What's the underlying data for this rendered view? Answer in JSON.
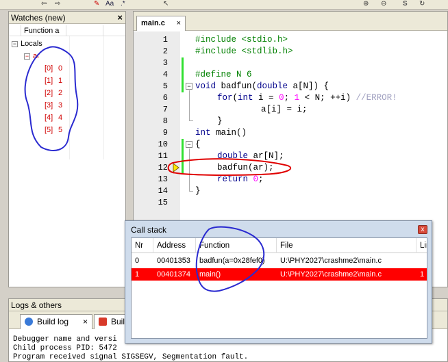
{
  "toolbar": {
    "icons": [
      "back-arrow-icon",
      "forward-arrow-icon",
      "highlight-icon",
      "match-case-icon",
      "regex-icon",
      "select-icon",
      "zoom-in-icon",
      "zoom-out-icon",
      "spell-check-icon",
      "refresh-icon"
    ],
    "match_case_label": "Aa",
    "regex_label": ".*",
    "spell_label": "S"
  },
  "watches": {
    "title": "Watches (new)",
    "close": "×",
    "column_function": "Function a",
    "locals_label": "Locals",
    "var_name": "ar",
    "items": [
      {
        "index": "[0]",
        "value": "0"
      },
      {
        "index": "[1]",
        "value": "1"
      },
      {
        "index": "[2]",
        "value": "2"
      },
      {
        "index": "[3]",
        "value": "3"
      },
      {
        "index": "[4]",
        "value": "4"
      },
      {
        "index": "[5]",
        "value": "5"
      }
    ]
  },
  "editor": {
    "tab_label": "main.c",
    "tab_close": "×",
    "line_numbers": [
      "1",
      "2",
      "3",
      "4",
      "5",
      "6",
      "7",
      "8",
      "9",
      "10",
      "11",
      "12",
      "13",
      "14",
      "15"
    ],
    "lines": {
      "l1": "#include <stdio.h>",
      "l2": "#include <stdlib.h>",
      "l4": "#define N 6",
      "l5a": "void",
      "l5b": " badfun(",
      "l5c": "double",
      "l5d": " a[N]) {",
      "l6a": "for",
      "l6b": "(",
      "l6c": "int",
      "l6d": " i = ",
      "l6e": "0",
      "l6f": "; ",
      "l6g": "1",
      "l6h": " < N; ++i) ",
      "l6i": "//ERROR!",
      "l7": "a[i] = i;",
      "l8": "}",
      "l9a": "int",
      "l9b": " main()",
      "l10": "{",
      "l11a": "double",
      "l11b": " ar[N];",
      "l12": "badfun(ar);",
      "l13a": "return",
      "l13b": " ",
      "l13c": "0",
      "l13d": ";",
      "l14": "}"
    },
    "fold_minus": "−"
  },
  "logs": {
    "title": "Logs & others",
    "tab_build_log": "Build log",
    "tab_build": "Build",
    "tab_close": "×",
    "lines": [
      "Debugger name and versi",
      "Child process PID: 5472",
      "Program received signal SIGSEGV, Segmentation fault."
    ]
  },
  "callstack": {
    "title": "Call stack",
    "close": "x",
    "columns": [
      "Nr",
      "Address",
      "Function",
      "File",
      "Lin"
    ],
    "rows": [
      {
        "nr": "0",
        "address": "00401353",
        "function": "badfun(a=0x28fef0)",
        "file": "U:\\PHY2027\\crashme2\\main.c",
        "line": ""
      },
      {
        "nr": "1",
        "address": "00401374",
        "function": "main()",
        "file": "U:\\PHY2027\\crashme2\\main.c",
        "line": "1"
      }
    ]
  },
  "annotations": {
    "pen_color": "#2a2ad0",
    "mark_color": "#e00000"
  }
}
